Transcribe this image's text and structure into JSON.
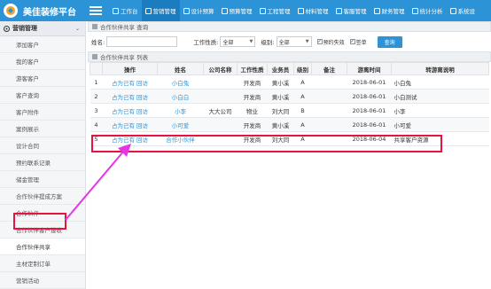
{
  "app": {
    "title": "美佳装修平台"
  },
  "nav": [
    {
      "label": "工作台",
      "icon": "home-icon"
    },
    {
      "label": "营销管理",
      "icon": "marketing-icon",
      "active": true
    },
    {
      "label": "设计预算",
      "icon": "edit-icon"
    },
    {
      "label": "预算管理",
      "icon": "monitor-icon"
    },
    {
      "label": "工程管理",
      "icon": "truck-icon"
    },
    {
      "label": "材料管理",
      "icon": "grid-icon"
    },
    {
      "label": "客服管理",
      "icon": "headset-icon"
    },
    {
      "label": "财务管理",
      "icon": "yen-icon"
    },
    {
      "label": "统计分析",
      "icon": "chart-icon"
    },
    {
      "label": "系统设",
      "icon": "gear-icon"
    }
  ],
  "sidebar": {
    "header": "营销管理",
    "items": [
      "添加客户",
      "我的客户",
      "游客客户",
      "客户查询",
      "客户附件",
      "案例展示",
      "设计合同",
      "预约联系记录",
      "储金管理",
      "合作伙伴提成方案",
      "合作伙伴",
      "合作伙伴客户接收",
      "合作伙伴共享",
      "主材定制订单",
      "营销活动"
    ],
    "selected_index": 12
  },
  "search_section": {
    "title": "合作伙伴共享 查询",
    "name_label": "姓名:",
    "name_value": "",
    "type_label": "工作性质:",
    "type_value": "全部",
    "level_label": "级别:",
    "level_value": "全部",
    "fail_label": "预约失效",
    "fail_checked": true,
    "signed_label": "签单",
    "signed_checked": true,
    "query_button": "查询"
  },
  "list_section": {
    "title": "合作伙伴共享 列表",
    "headers": [
      "",
      "操作",
      "姓名",
      "公司名称",
      "工作性质",
      "业务员",
      "级别",
      "备注",
      "游离时间",
      "转游离说明"
    ],
    "rows": [
      {
        "no": "1",
        "op1": "占为己有",
        "op2": "回访",
        "name": "小白兔",
        "company": "",
        "type": "开发商",
        "sales": "黄小溪",
        "level": "A",
        "remark": "",
        "time": "2018-06-01",
        "note": "小白兔"
      },
      {
        "no": "2",
        "op1": "占为己有",
        "op2": "回访",
        "name": "小白白",
        "company": "",
        "type": "开发商",
        "sales": "黄小溪",
        "level": "A",
        "remark": "",
        "time": "2018-06-01",
        "note": "小白测试"
      },
      {
        "no": "3",
        "op1": "占为己有",
        "op2": "回访",
        "name": "小李",
        "company": "大大公司",
        "type": "物业",
        "sales": "刘大同",
        "level": "B",
        "remark": "",
        "time": "2018-06-01",
        "note": "小李"
      },
      {
        "no": "4",
        "op1": "占为己有",
        "op2": "回访",
        "name": "小可爱",
        "company": "",
        "type": "开发商",
        "sales": "黄小溪",
        "level": "A",
        "remark": "",
        "time": "2018-06-01",
        "note": "小可爱"
      },
      {
        "no": "5",
        "op1": "占为己有",
        "op2": "回访",
        "name": "合作小伙伴",
        "company": "",
        "type": "开发商",
        "sales": "刘大同",
        "level": "A",
        "remark": "",
        "time": "2018-06-04",
        "note": "共享客户资源"
      }
    ]
  },
  "colors": {
    "brand": "#2c93d6",
    "highlight": "#e8123e",
    "arrow": "#e535e5"
  }
}
